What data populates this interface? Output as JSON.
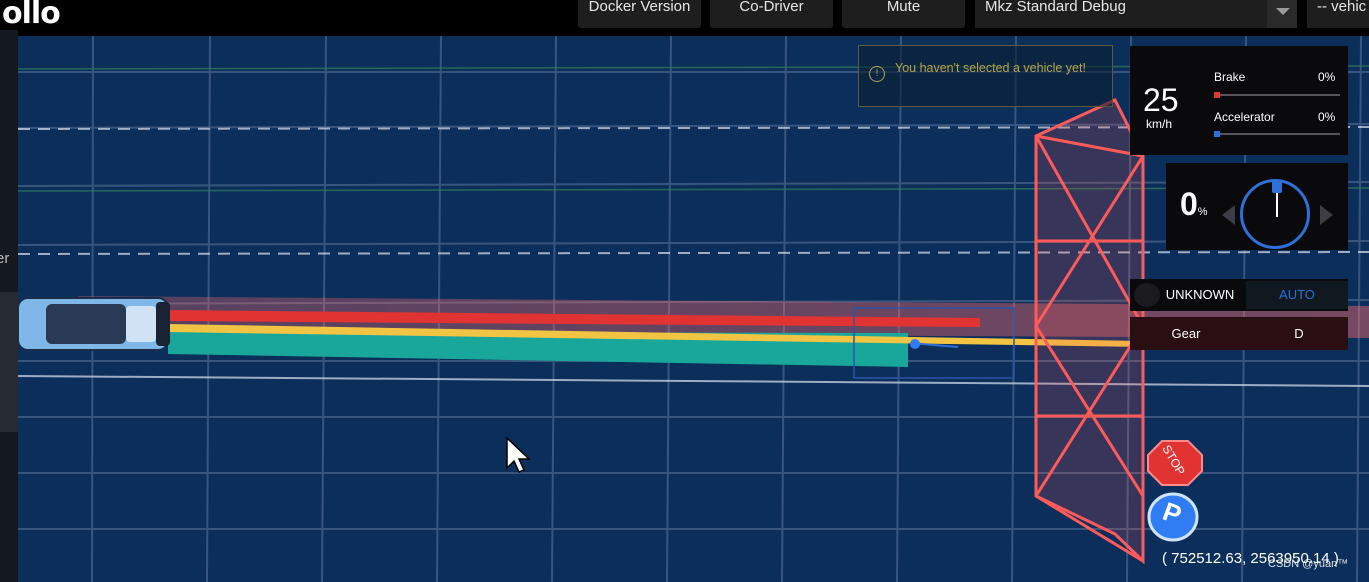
{
  "app": {
    "logo": "ollo"
  },
  "toolbar": {
    "docker_version": "Docker Version",
    "co_driver": "Co-Driver",
    "mute": "Mute",
    "mode_select_value": "Mkz Standard Debug",
    "vehicle_select_value": "-- vehic"
  },
  "left_panel": {
    "label": "er"
  },
  "notification": {
    "message": "You haven't selected a vehicle yet!"
  },
  "dashboard": {
    "speed_value": "25",
    "speed_unit": "km/h",
    "brake_label": "Brake",
    "brake_value": "0%",
    "brake_fraction": 0.0,
    "accelerator_label": "Accelerator",
    "accelerator_value": "0%",
    "accelerator_fraction": 0.0,
    "steering_value": "0",
    "steering_unit": "%",
    "driving_mode_status": "UNKNOWN",
    "driving_mode_auto": "AUTO",
    "gear_label": "Gear",
    "gear_value": "D"
  },
  "signs": {
    "stop_label": "STOP",
    "parking_label": "P"
  },
  "position": {
    "coordinates": "( 752512.63, 2563950.14 )"
  },
  "watermark": "CSDN @yuan™",
  "colors": {
    "scene_background": "#0c2e5b",
    "planning_red": "#e23333",
    "planning_yellow": "#f2c443",
    "planning_teal": "#1aa79b",
    "stop_fence": "#ff5a5a",
    "brake_marker": "#e23333",
    "accelerator_marker": "#2f6fd8",
    "auto_text": "#2f6fd8"
  },
  "icons": [
    "warning-icon",
    "cursor-icon",
    "car-icon",
    "stop-sign-icon",
    "parking-sign-icon",
    "steering-dial-icon"
  ]
}
